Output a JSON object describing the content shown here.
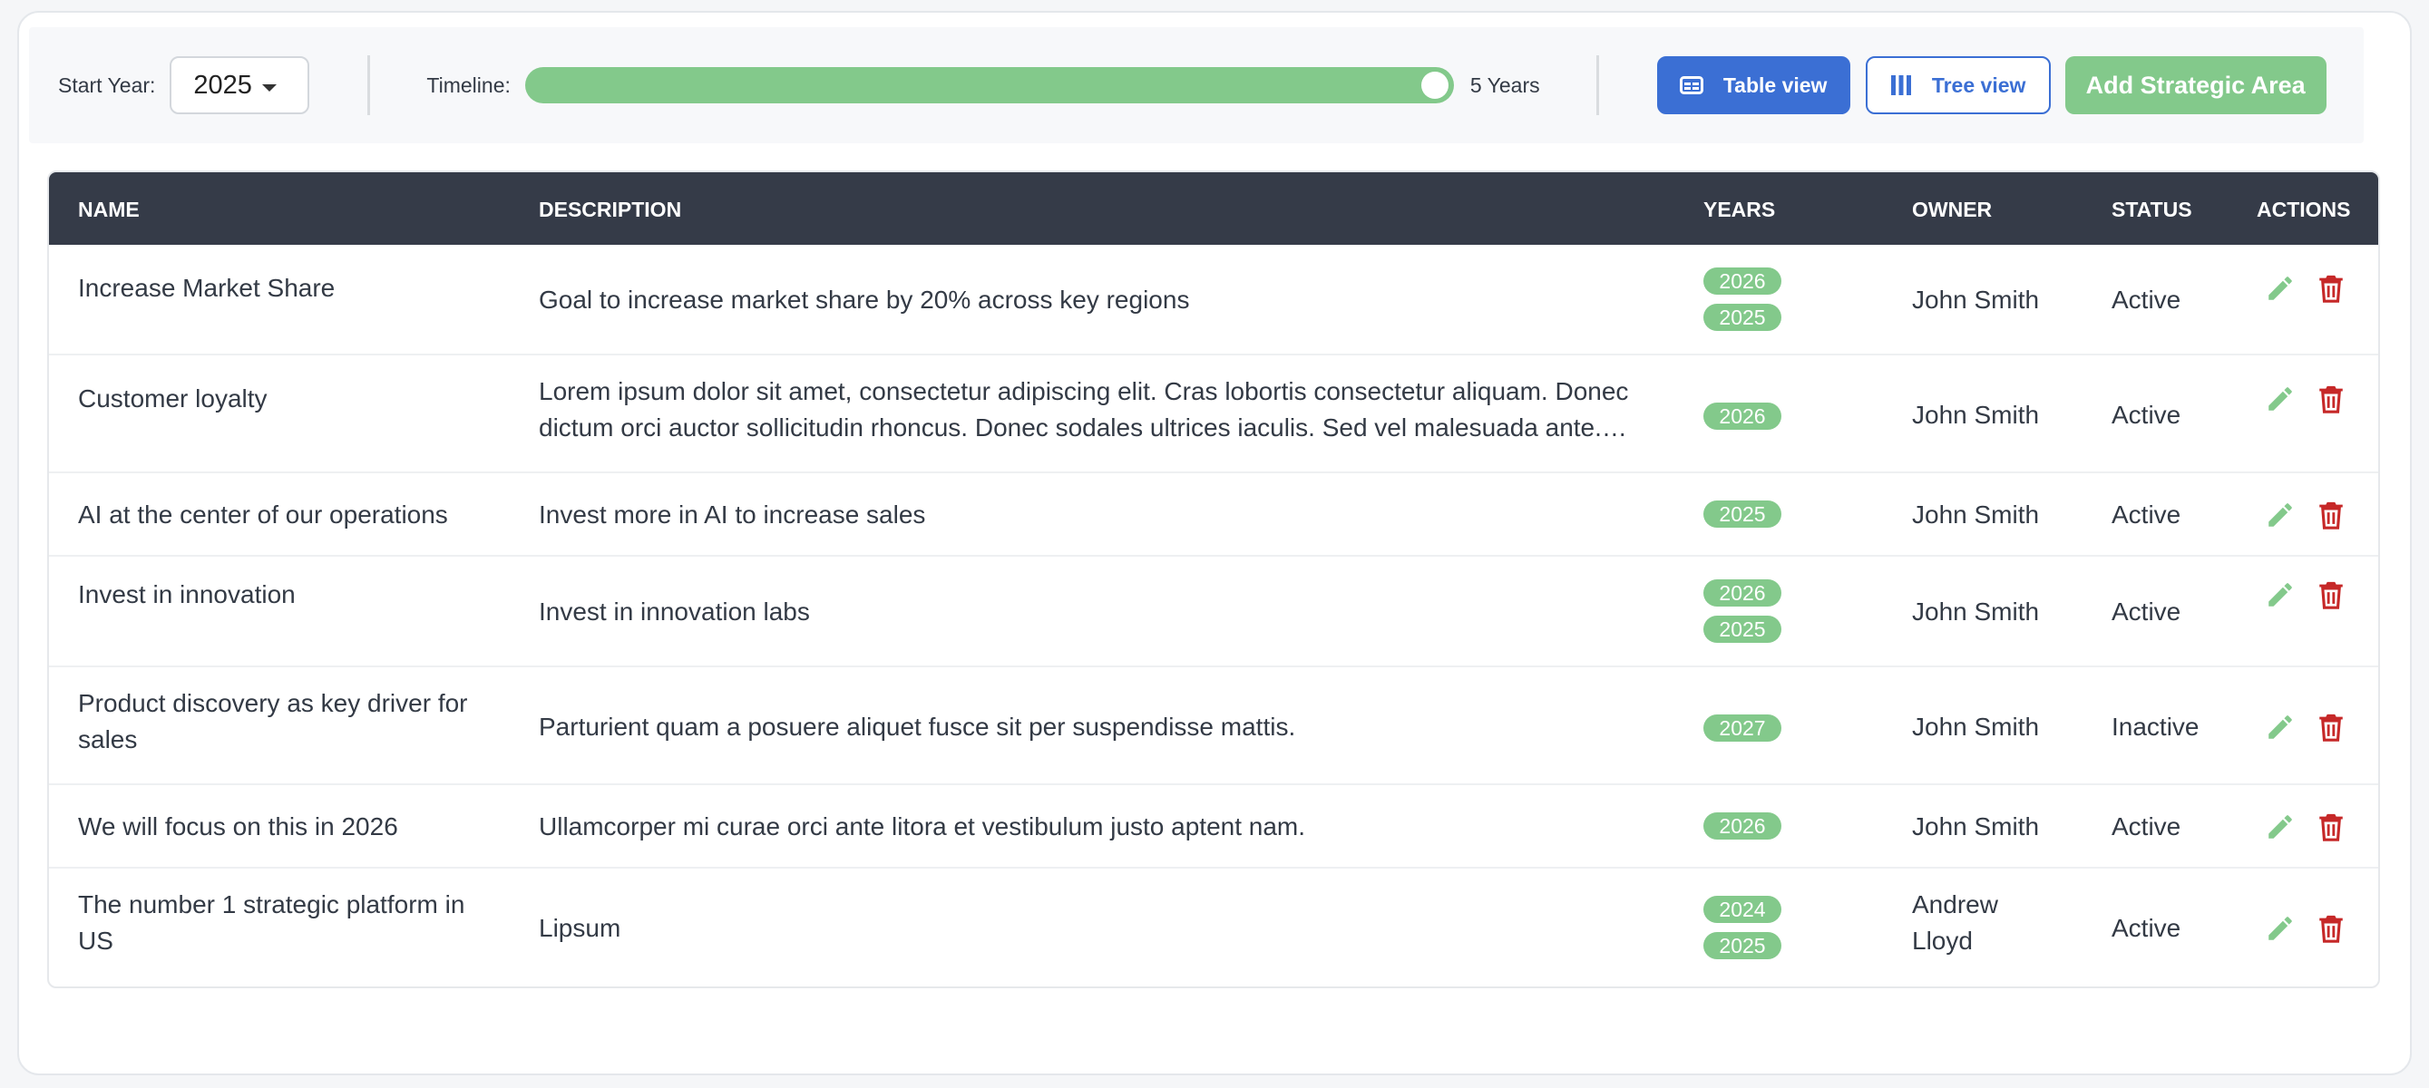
{
  "toolbar": {
    "start_year_label": "Start Year:",
    "start_year_value": "2025",
    "timeline_label": "Timeline:",
    "timeline_value": "5 Years",
    "timeline_fraction": 1.0,
    "table_view_label": "Table view",
    "tree_view_label": "Tree view",
    "add_label": "Add Strategic Area"
  },
  "table": {
    "headers": {
      "name": "NAME",
      "description": "DESCRIPTION",
      "years": "YEARS",
      "owner": "OWNER",
      "status": "STATUS",
      "actions": "ACTIONS"
    },
    "rows": [
      {
        "name": "Increase Market Share",
        "description": "Goal to increase market share by 20% across key regions",
        "years": [
          "2026",
          "2025"
        ],
        "owner": "John Smith",
        "status": "Active"
      },
      {
        "name": "Customer loyalty",
        "description": "Lorem ipsum dolor sit amet, consectetur adipiscing elit. Cras lobortis consectetur aliquam. Donec dictum orci auctor sollicitudin rhoncus. Donec sodales ultrices iaculis. Sed vel malesuada ante.…",
        "years": [
          "2026"
        ],
        "owner": "John Smith",
        "status": "Active"
      },
      {
        "name": "AI at the center of our operations",
        "description": "Invest more in AI to increase sales",
        "years": [
          "2025"
        ],
        "owner": "John Smith",
        "status": "Active"
      },
      {
        "name": "Invest in innovation",
        "description": "Invest in innovation labs",
        "years": [
          "2026",
          "2025"
        ],
        "owner": "John Smith",
        "status": "Active"
      },
      {
        "name": "Product discovery as key driver for sales",
        "description": "Parturient quam a posuere aliquet fusce sit per suspendisse mattis.",
        "years": [
          "2027"
        ],
        "owner": "John Smith",
        "status": "Inactive"
      },
      {
        "name": "We will focus on this in 2026",
        "description": "Ullamcorper mi curae orci ante litora et vestibulum justo aptent nam.",
        "years": [
          "2026"
        ],
        "owner": "John Smith",
        "status": "Active"
      },
      {
        "name": "The number 1 strategic platform in US",
        "description": "Lipsum",
        "years": [
          "2024",
          "2025"
        ],
        "owner": "Andrew Lloyd",
        "status": "Active"
      }
    ]
  },
  "colors": {
    "accent_blue": "#3b6fd4",
    "accent_green": "#83c98b",
    "header_dark": "#353b48",
    "delete_red": "#c62828"
  },
  "icons": {
    "dropdown": "caret-down-icon",
    "table_view": "table-icon",
    "tree_view": "columns-icon",
    "edit": "pencil-icon",
    "delete": "trash-icon"
  }
}
